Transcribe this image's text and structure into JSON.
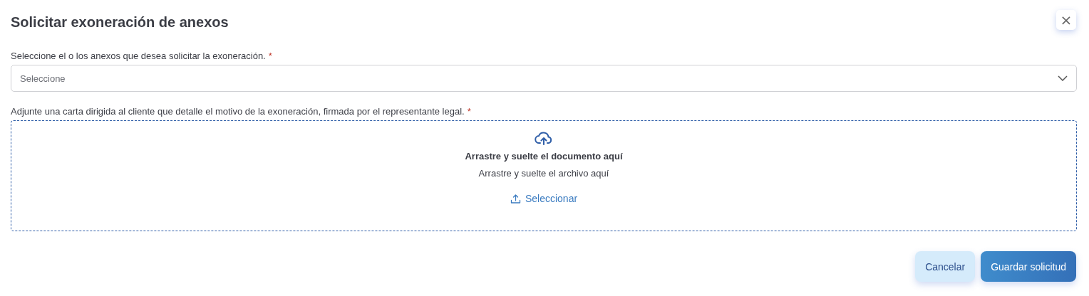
{
  "dialog": {
    "title": "Solicitar exoneración de anexos",
    "close": "×"
  },
  "fields": [
    {
      "kind": "select",
      "label": "Seleccione el o los anexos que desea solicitar la exoneración.",
      "required_mark": "*",
      "placeholder": "Seleccione"
    },
    {
      "kind": "upload",
      "label": "Adjunte una carta dirigida al cliente que detalle el motivo de la exoneración, firmada por el representante legal.",
      "required_mark": "*",
      "title": "Arrastre y suelte el documento aquí",
      "subtitle": "Arrastre y suelte el archivo aquí",
      "action": "Seleccionar"
    }
  ],
  "buttons": [
    {
      "kind": "secondary",
      "label": "Cancelar"
    },
    {
      "kind": "primary",
      "label": "Guardar solicitud"
    }
  ]
}
